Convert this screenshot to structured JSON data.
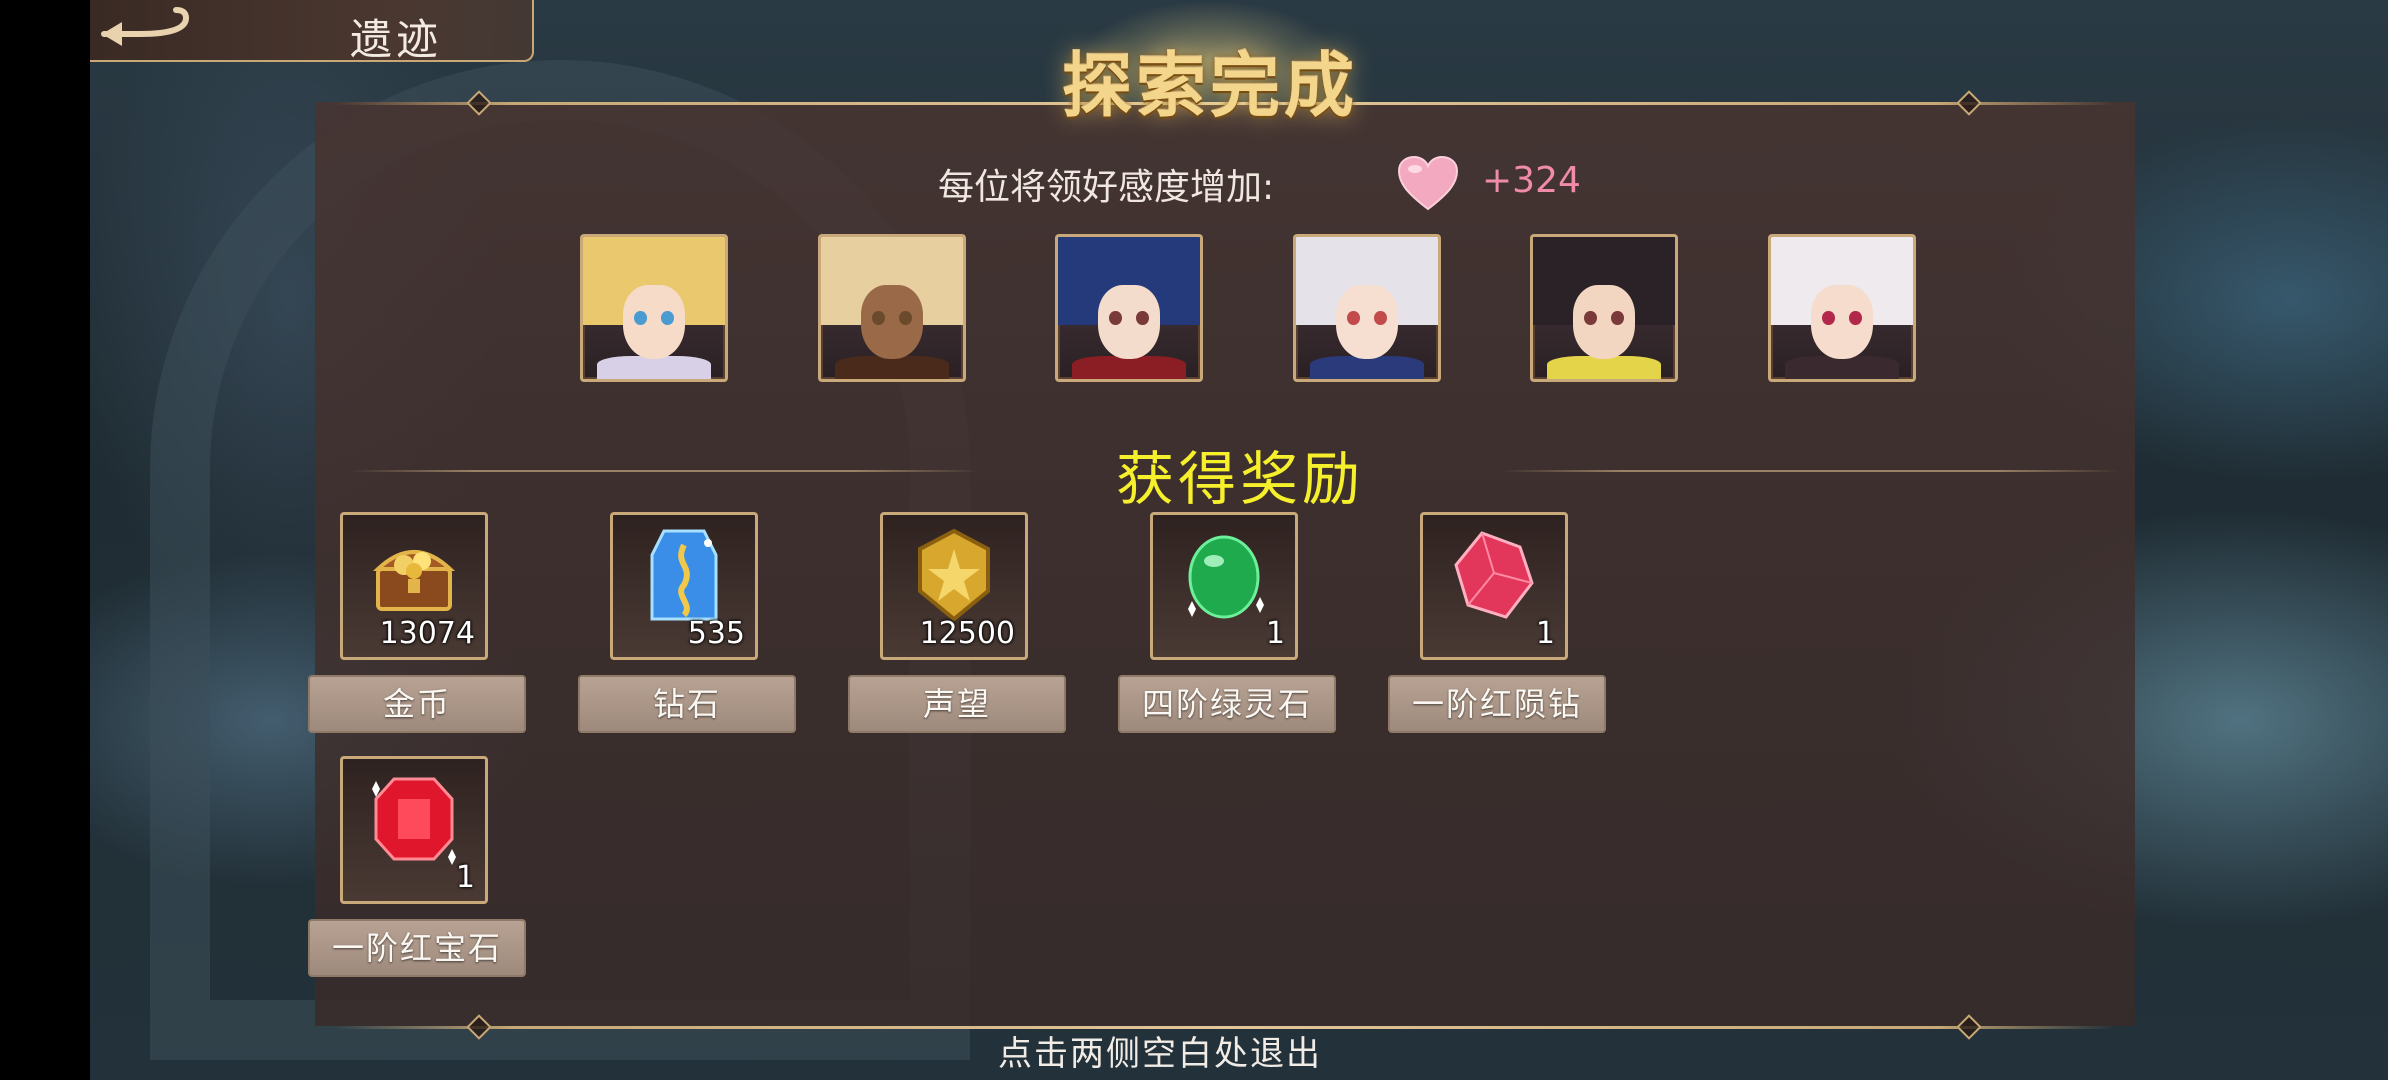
{
  "header": {
    "page_title": "遗迹"
  },
  "result": {
    "title": "探索完成",
    "affinity_label": "每位将领好感度增加:",
    "affinity_value": "+324"
  },
  "heroes": [
    {
      "hair": "#e9c86e",
      "skin": "#f6dcc8",
      "eye": "#4a9bd0",
      "body": "#d8d0e6"
    },
    {
      "hair": "#e8cfa0",
      "skin": "#9a6a48",
      "eye": "#6a4a2a",
      "body": "#4a2a1a"
    },
    {
      "hair": "#243a7a",
      "skin": "#f4dccc",
      "eye": "#7a3a3a",
      "body": "#8a1e24"
    },
    {
      "hair": "#e6e2ea",
      "skin": "#f6ded0",
      "eye": "#c24a4a",
      "body": "#2a3a7a"
    },
    {
      "hair": "#2a2226",
      "skin": "#f2d6c2",
      "eye": "#7a3a3a",
      "body": "#e4d44a"
    },
    {
      "hair": "#eeeaee",
      "skin": "#f6dccc",
      "eye": "#b2284a",
      "body": "#3a2a30"
    }
  ],
  "rewards_title": "获得奖励",
  "rewards": [
    {
      "icon": "treasure-chest-icon",
      "count": "13074",
      "name": "金币"
    },
    {
      "icon": "diamond-crystal-icon",
      "count": "535",
      "name": "钻石"
    },
    {
      "icon": "prestige-badge-icon",
      "count": "12500",
      "name": "声望"
    },
    {
      "icon": "green-spirit-stone-icon",
      "count": "1",
      "name": "四阶绿灵石"
    },
    {
      "icon": "red-meteor-diamond-icon",
      "count": "1",
      "name": "一阶红陨钻"
    },
    {
      "icon": "red-ruby-icon",
      "count": "1",
      "name": "一阶红宝石"
    }
  ],
  "footer": {
    "exit_hint": "点击两侧空白处退出"
  },
  "colors": {
    "accent_gold": "#c8a876",
    "title_yellow": "#f6ef2c",
    "affinity_pink": "#f08ca8"
  }
}
